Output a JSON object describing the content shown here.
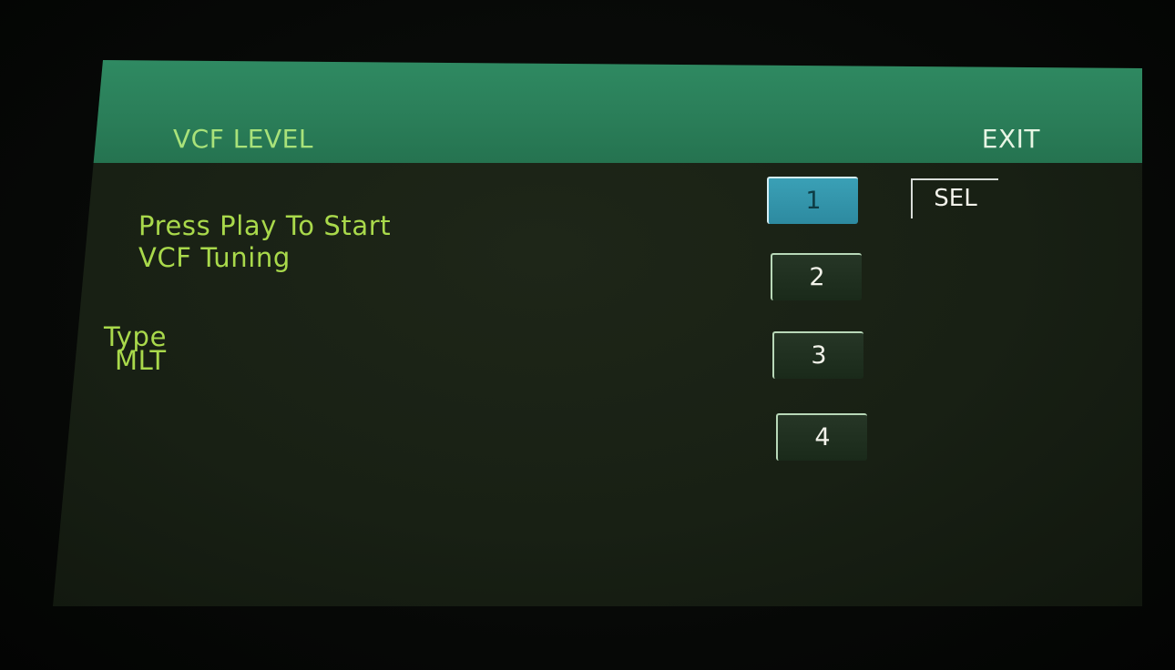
{
  "header": {
    "title": "VCF LEVEL",
    "exit_label": "EXIT"
  },
  "message": {
    "line1": "Press Play To Start",
    "line2": "VCF Tuning"
  },
  "type": {
    "label": "Type",
    "value": "MLT"
  },
  "buttons": [
    {
      "label": "1",
      "active": true
    },
    {
      "label": "2",
      "active": false
    },
    {
      "label": "3",
      "active": false
    },
    {
      "label": "4",
      "active": false
    }
  ],
  "sel_label": "SEL",
  "colors": {
    "header_bg": "#2a7d58",
    "title_text": "#a9e27a",
    "body_text": "#a9d94b",
    "active_button": "#3aa0b6"
  }
}
